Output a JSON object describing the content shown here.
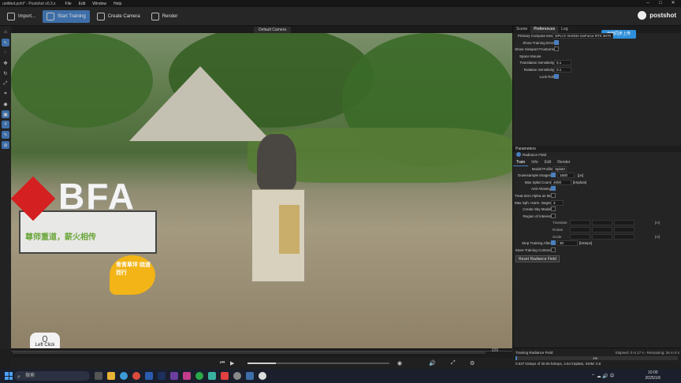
{
  "window": {
    "title": "untitled.psht* - Postshot v0.3.x",
    "menu": [
      "File",
      "Edit",
      "Window",
      "Help"
    ]
  },
  "toolbar": {
    "import_label": "Import...",
    "start_training_label": "Start Training",
    "create_camera_label": "Create Camera",
    "render_label": "Render",
    "logo_text": "postshot"
  },
  "viewport": {
    "tab_label": "Default Camera",
    "scene": {
      "sign_text": "BFA",
      "slogan_text": "尊师重道，薪火相传",
      "leaf_text": "青青草坪 绕道而行"
    },
    "left_click_label": "Left Click"
  },
  "timeline": {
    "total_frames": "229",
    "current_frame": "0"
  },
  "right_panel": {
    "tabs": [
      "Scene",
      "Preferences",
      "Log"
    ],
    "selected_tab": "Preferences",
    "sync_badge": "画面同步上传",
    "prefs": {
      "primary_compute_label": "Primary Compute Device",
      "primary_compute_value": "GPU 0: NVIDIA GeForce RTX 3070",
      "show_training_error_label": "Show Training Error",
      "show_training_error": true,
      "viewport_frustums_label": "Show Viewport Frustums",
      "viewport_frustums": false,
      "space_mouse_label": "Space Mouse",
      "translation_label": "Translation Sensitivity",
      "translation_value": "0.1",
      "rotation_label": "Rotation Sensitivity",
      "rotation_value": "0.1",
      "lock_roll_label": "Lock Roll",
      "lock_roll": true
    },
    "params_title": "Parameters",
    "radiance_field_label": "Radiance Field",
    "subtabs": [
      "Train",
      "Info",
      "Edit",
      "Render"
    ],
    "selected_subtab": "Train",
    "params": {
      "model_profile_label": "Model Profile",
      "model_profile_value": "Splat3",
      "downsample_label": "Downsample Images",
      "downsample_value": "1600",
      "downsample_unit": "[px]",
      "max_splat_label": "Max Splat Count",
      "max_splat_value": "4000",
      "max_splat_unit": "[kSplats]",
      "anti_aliasing_label": "Anti-Aliasing",
      "treat_zero_alpha_label": "Treat Zero Alpha as Mask",
      "max_sph_label": "Max Sph. Harm. Degree",
      "max_sph_value": "3",
      "create_sky_label": "Create Sky Model",
      "roi_label": "Region of Interest",
      "roi_translate": "Translate",
      "roi_rotate": "Rotate",
      "roi_scale": "Scale",
      "roi_unit": "[m]",
      "stop_training_label": "Stop Training After",
      "stop_training_value": "30",
      "stop_training_unit": "[kSteps]",
      "store_contour_label": "Store Training Contour",
      "reset_label": "Reset Radiance Field"
    }
  },
  "status": {
    "title": "Training Radiance Field",
    "elapsed": "Elapsed: 0 m 17 s - Remaining: 26 m 0 s",
    "progress_pct": "1%",
    "progress_fraction": 0.01,
    "details": "0.637 kSteps of 30.00 kSteps, 3.64 kSplats, SSIM: 0.8"
  },
  "taskbar": {
    "search_placeholder": "搜索",
    "time": "10:00",
    "date": "2025/1/6"
  }
}
